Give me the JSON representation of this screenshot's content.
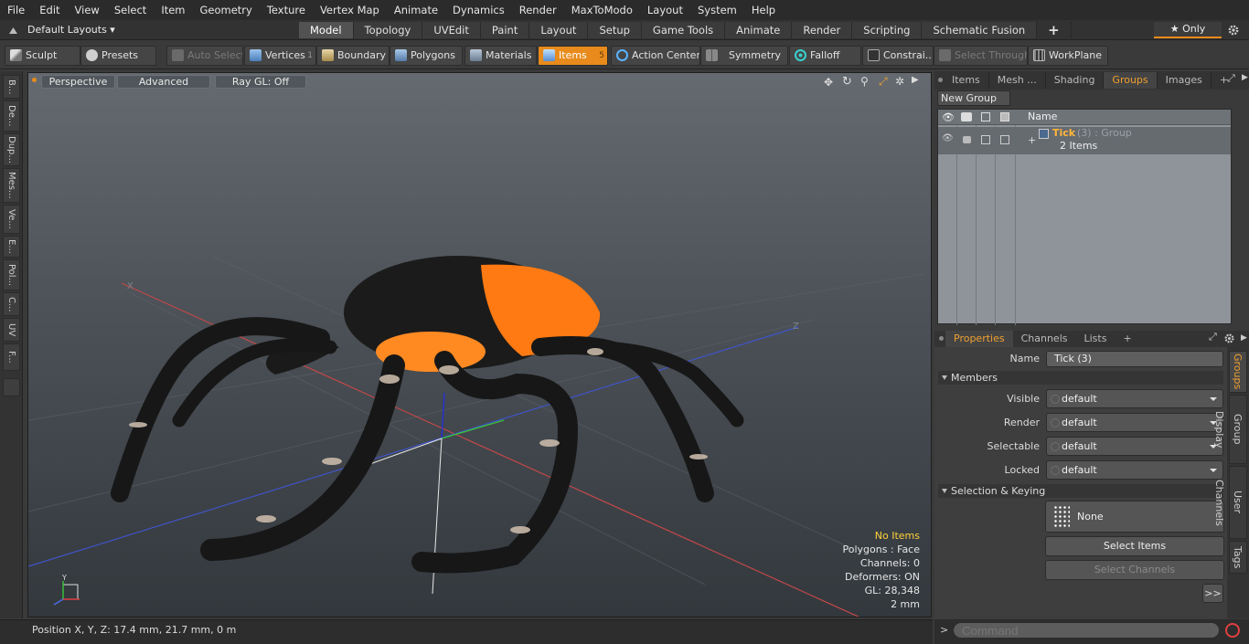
{
  "menu": [
    "File",
    "Edit",
    "View",
    "Select",
    "Item",
    "Geometry",
    "Texture",
    "Vertex Map",
    "Animate",
    "Dynamics",
    "Render",
    "MaxToModo",
    "Layout",
    "System",
    "Help"
  ],
  "layout": {
    "selector": "Default Layouts ▾"
  },
  "mode_tabs": [
    "Model",
    "Topology",
    "UVEdit",
    "Paint",
    "Layout",
    "Setup",
    "Game Tools",
    "Animate",
    "Render",
    "Scripting",
    "Schematic Fusion"
  ],
  "mode_tabs_add": "+",
  "only_label": "★  Only",
  "settings_icon": "gear-icon",
  "toolbar": {
    "sculpt": "Sculpt",
    "presets": "Presets",
    "auto_select": "Auto Select",
    "vertices": "Vertices",
    "vertices_count": "1",
    "boundary": "Boundary",
    "polygons": "Polygons",
    "materials": "Materials",
    "items": "Items",
    "items_count": "5",
    "action_center": "Action Center",
    "symmetry": "Symmetry",
    "falloff": "Falloff",
    "constraints": "Constrai...",
    "select_through": "Select Through",
    "workplane": "WorkPlane"
  },
  "left_strip": [
    "B...",
    "De...",
    "Dup...",
    "Mes...",
    "Ve...",
    "E...",
    "Pol...",
    "C...",
    "UV",
    "F..."
  ],
  "viewport": {
    "view": "Perspective",
    "shading": "Advanced",
    "raygl": "Ray GL: Off",
    "info": {
      "selection": "No Items",
      "polygons": "Polygons : Face",
      "channels": "Channels: 0",
      "deformers": "Deformers: ON",
      "gl": "GL: 28,348",
      "scale": "2 mm"
    },
    "axis_x": "X",
    "axis_y": "Y",
    "axis_z": "Z"
  },
  "status": {
    "position": "Position X, Y, Z:   17.4 mm, 21.7 mm, 0 m"
  },
  "right_tabs": [
    "Items",
    "Mesh ...",
    "Shading",
    "Groups",
    "Images"
  ],
  "right_tabs_add": "+",
  "groups": {
    "new_group": "New Group",
    "col_name": "Name",
    "row": {
      "name": "Tick",
      "suffix": " (3) : Group",
      "items": "2 Items"
    }
  },
  "props_tabs": [
    "Properties",
    "Channels",
    "Lists"
  ],
  "props_tabs_add": "+",
  "props": {
    "name_label": "Name",
    "name_value": "Tick (3)",
    "members_section": "Members",
    "visible_label": "Visible",
    "visible_value": "default",
    "render_label": "Render",
    "render_value": "default",
    "selectable_label": "Selectable",
    "selectable_value": "default",
    "locked_label": "Locked",
    "locked_value": "default",
    "selection_section": "Selection & Keying",
    "none_label": "None",
    "select_items": "Select Items",
    "select_channels": "Select Channels",
    "more": ">>"
  },
  "vtabs": [
    "Groups",
    "Group Display",
    "User Channels",
    "Tags"
  ],
  "command": {
    "prompt": ">",
    "placeholder": "Command"
  }
}
